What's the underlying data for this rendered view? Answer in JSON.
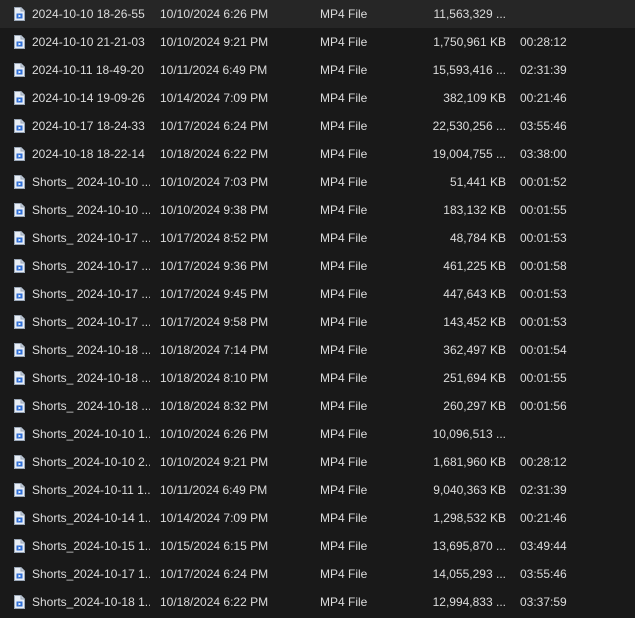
{
  "icons": {
    "file": "video-file-icon"
  },
  "colors": {
    "background": "#191919",
    "text": "#dcdcdc",
    "icon_page": "#e8eef6",
    "icon_accent": "#2f6fd6"
  },
  "files": [
    {
      "name": "2024-10-10 18-26-55",
      "date": "10/10/2024 6:26 PM",
      "type": "MP4 File",
      "size": "11,563,329 ...",
      "length": ""
    },
    {
      "name": "2024-10-10 21-21-03",
      "date": "10/10/2024 9:21 PM",
      "type": "MP4 File",
      "size": "1,750,961 KB",
      "length": "00:28:12"
    },
    {
      "name": "2024-10-11 18-49-20",
      "date": "10/11/2024 6:49 PM",
      "type": "MP4 File",
      "size": "15,593,416 ...",
      "length": "02:31:39"
    },
    {
      "name": "2024-10-14 19-09-26",
      "date": "10/14/2024 7:09 PM",
      "type": "MP4 File",
      "size": "382,109 KB",
      "length": "00:21:46"
    },
    {
      "name": "2024-10-17 18-24-33",
      "date": "10/17/2024 6:24 PM",
      "type": "MP4 File",
      "size": "22,530,256 ...",
      "length": "03:55:46"
    },
    {
      "name": "2024-10-18 18-22-14",
      "date": "10/18/2024 6:22 PM",
      "type": "MP4 File",
      "size": "19,004,755 ...",
      "length": "03:38:00"
    },
    {
      "name": "Shorts_ 2024-10-10 ...",
      "date": "10/10/2024 7:03 PM",
      "type": "MP4 File",
      "size": "51,441 KB",
      "length": "00:01:52"
    },
    {
      "name": "Shorts_ 2024-10-10 ...",
      "date": "10/10/2024 9:38 PM",
      "type": "MP4 File",
      "size": "183,132 KB",
      "length": "00:01:55"
    },
    {
      "name": "Shorts_ 2024-10-17 ...",
      "date": "10/17/2024 8:52 PM",
      "type": "MP4 File",
      "size": "48,784 KB",
      "length": "00:01:53"
    },
    {
      "name": "Shorts_ 2024-10-17 ...",
      "date": "10/17/2024 9:36 PM",
      "type": "MP4 File",
      "size": "461,225 KB",
      "length": "00:01:58"
    },
    {
      "name": "Shorts_ 2024-10-17 ...",
      "date": "10/17/2024 9:45 PM",
      "type": "MP4 File",
      "size": "447,643 KB",
      "length": "00:01:53"
    },
    {
      "name": "Shorts_ 2024-10-17 ...",
      "date": "10/17/2024 9:58 PM",
      "type": "MP4 File",
      "size": "143,452 KB",
      "length": "00:01:53"
    },
    {
      "name": "Shorts_ 2024-10-18 ...",
      "date": "10/18/2024 7:14 PM",
      "type": "MP4 File",
      "size": "362,497 KB",
      "length": "00:01:54"
    },
    {
      "name": "Shorts_ 2024-10-18 ...",
      "date": "10/18/2024 8:10 PM",
      "type": "MP4 File",
      "size": "251,694 KB",
      "length": "00:01:55"
    },
    {
      "name": "Shorts_ 2024-10-18 ...",
      "date": "10/18/2024 8:32 PM",
      "type": "MP4 File",
      "size": "260,297 KB",
      "length": "00:01:56"
    },
    {
      "name": "Shorts_2024-10-10 1...",
      "date": "10/10/2024 6:26 PM",
      "type": "MP4 File",
      "size": "10,096,513 ...",
      "length": ""
    },
    {
      "name": "Shorts_2024-10-10 2...",
      "date": "10/10/2024 9:21 PM",
      "type": "MP4 File",
      "size": "1,681,960 KB",
      "length": "00:28:12"
    },
    {
      "name": "Shorts_2024-10-11 1...",
      "date": "10/11/2024 6:49 PM",
      "type": "MP4 File",
      "size": "9,040,363 KB",
      "length": "02:31:39"
    },
    {
      "name": "Shorts_2024-10-14 1...",
      "date": "10/14/2024 7:09 PM",
      "type": "MP4 File",
      "size": "1,298,532 KB",
      "length": "00:21:46"
    },
    {
      "name": "Shorts_2024-10-15 1...",
      "date": "10/15/2024 6:15 PM",
      "type": "MP4 File",
      "size": "13,695,870 ...",
      "length": "03:49:44"
    },
    {
      "name": "Shorts_2024-10-17 1...",
      "date": "10/17/2024 6:24 PM",
      "type": "MP4 File",
      "size": "14,055,293 ...",
      "length": "03:55:46"
    },
    {
      "name": "Shorts_2024-10-18 1...",
      "date": "10/18/2024 6:22 PM",
      "type": "MP4 File",
      "size": "12,994,833 ...",
      "length": "03:37:59"
    }
  ]
}
